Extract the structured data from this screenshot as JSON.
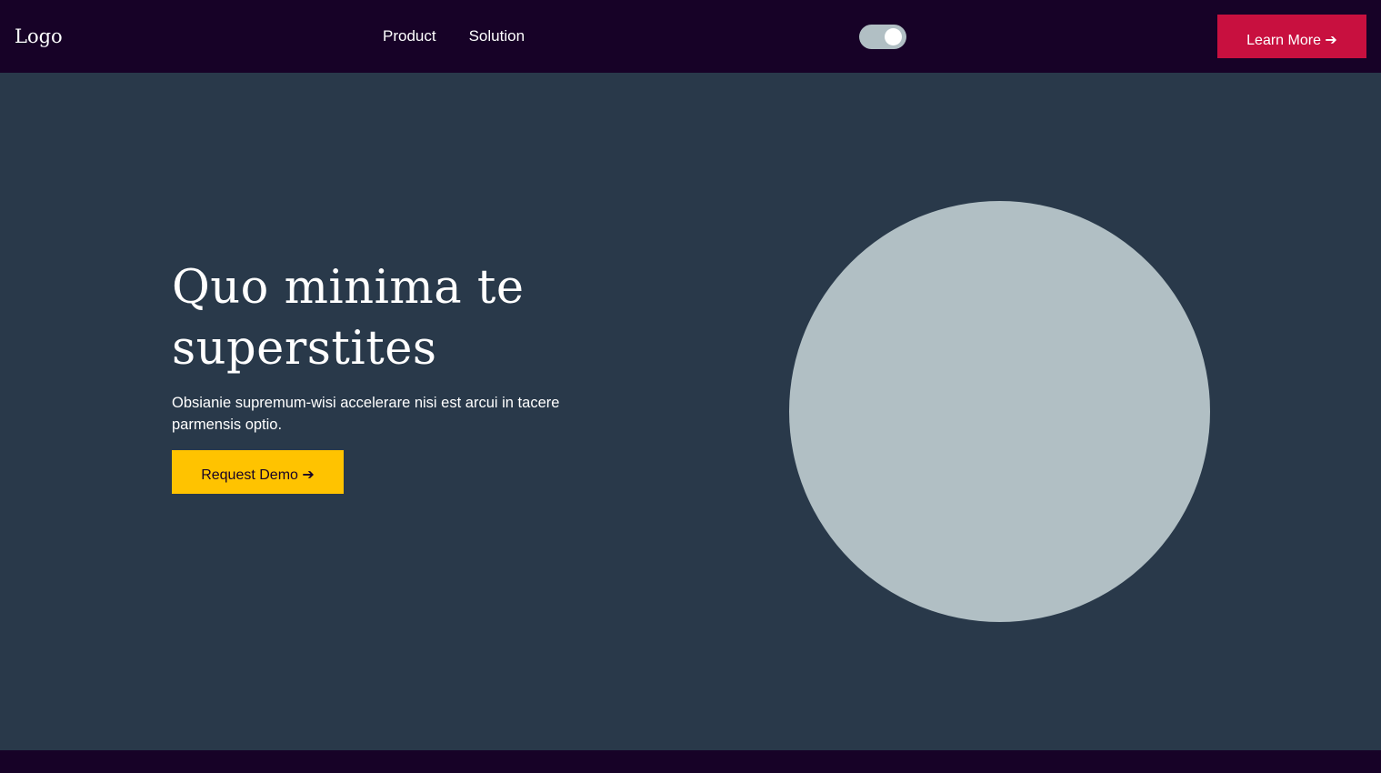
{
  "header": {
    "logo": "Logo",
    "nav": [
      {
        "label": "Product"
      },
      {
        "label": "Solution"
      }
    ],
    "toggle_state": "on",
    "cta_label": "Learn More ➔"
  },
  "hero": {
    "title": "Quo minima te superstites",
    "description": "Obsianie supremum-wisi accelerare nisi est arcui in tacere parmensis optio.",
    "cta_label": "Request Demo ➔"
  },
  "colors": {
    "header_bg": "#170227",
    "hero_bg": "#29394a",
    "accent_primary": "#c8103f",
    "accent_secondary": "#ffc300",
    "placeholder": "#b1bfc4"
  }
}
